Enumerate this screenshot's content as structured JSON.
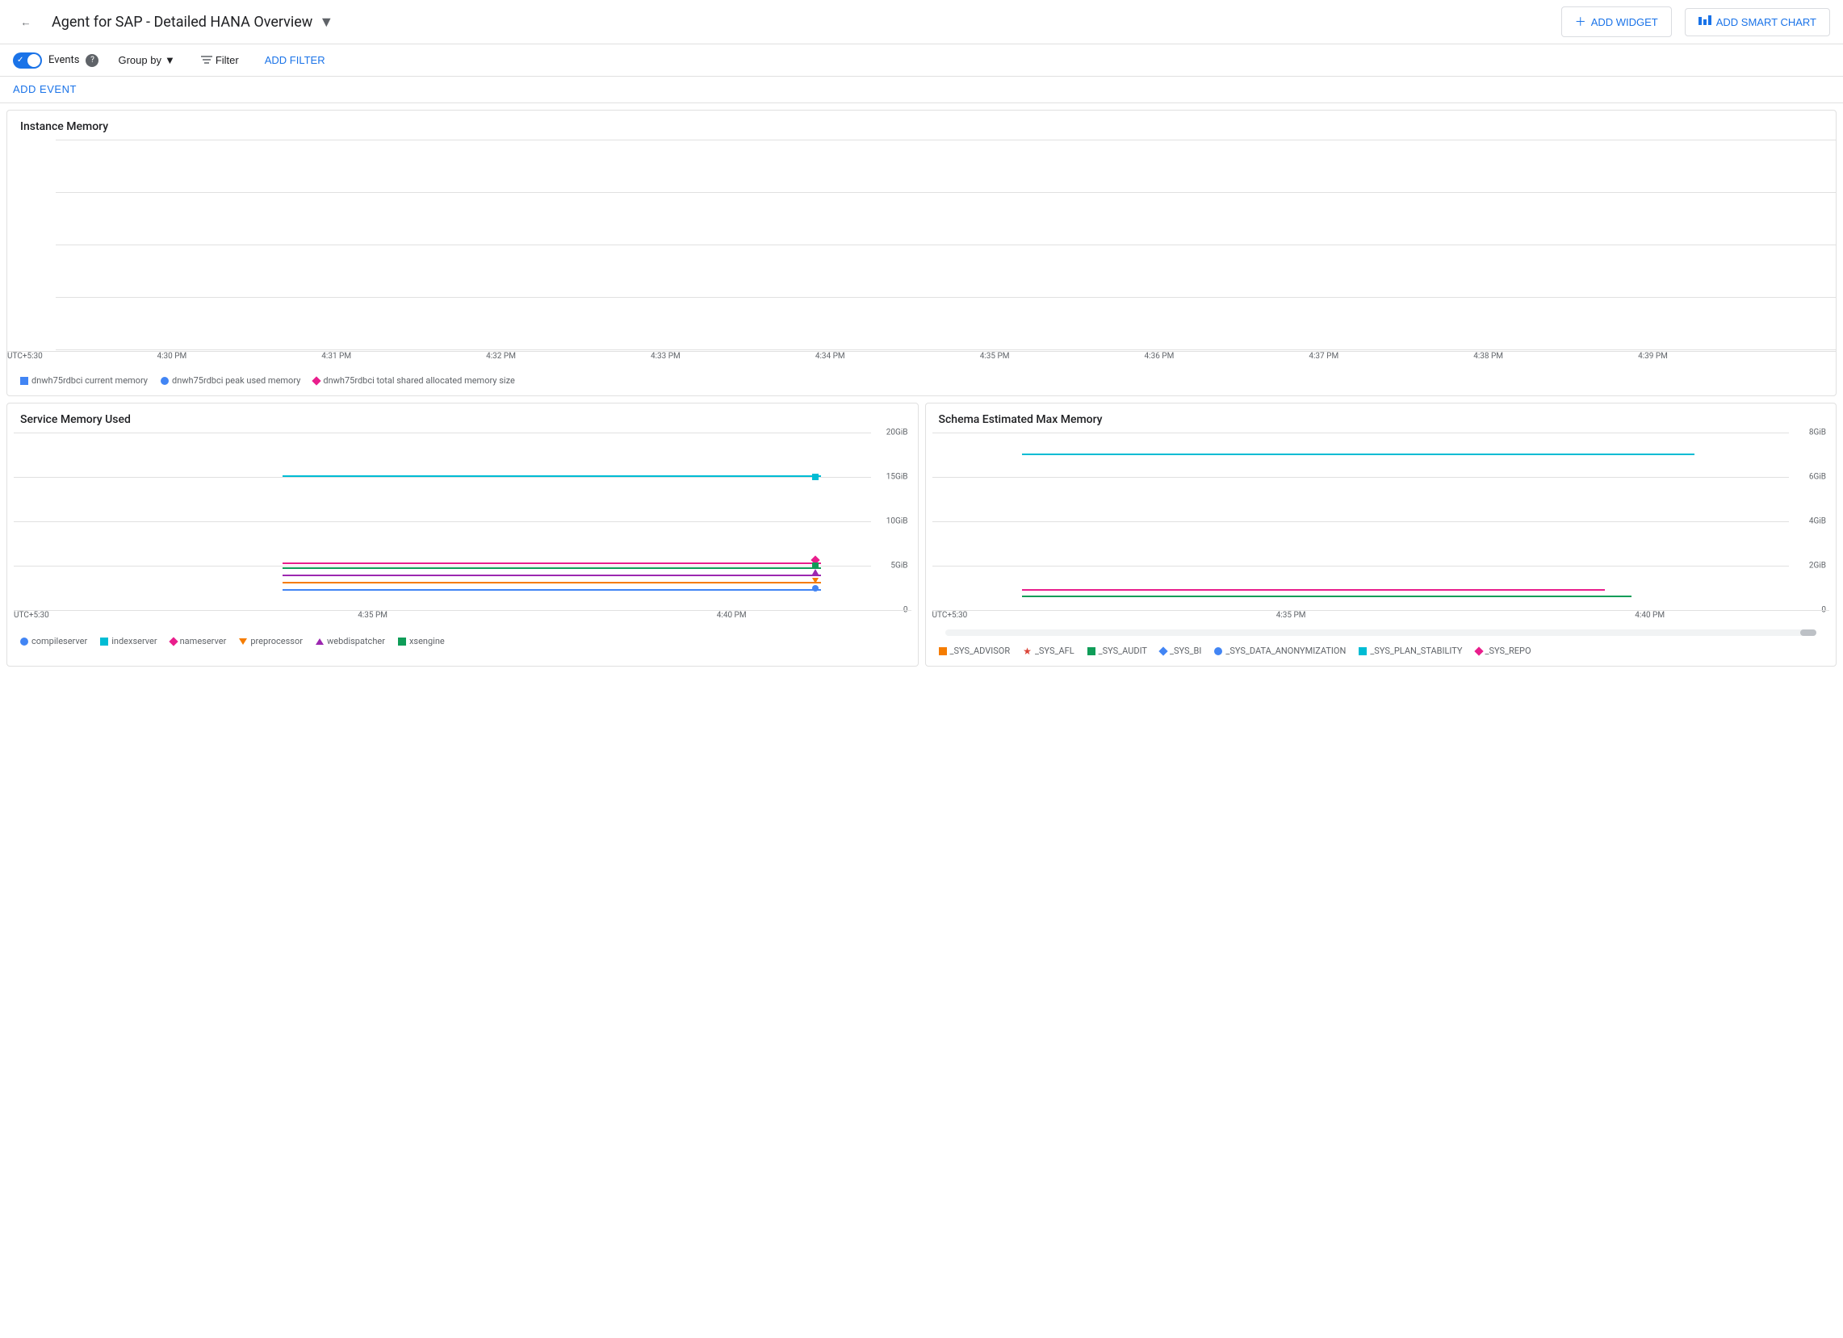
{
  "header": {
    "title": "Agent for SAP - Detailed HANA Overview",
    "title_dropdown_char": "▾",
    "back_icon": "←",
    "add_widget_label": "ADD WIDGET",
    "add_smart_chart_label": "ADD SMART CHART"
  },
  "toolbar": {
    "events_label": "Events",
    "group_by_label": "Group by",
    "filter_label": "Filter",
    "add_filter_label": "ADD FILTER"
  },
  "add_event": {
    "label": "ADD EVENT"
  },
  "instance_memory_chart": {
    "title": "Instance Memory",
    "x_labels": [
      "UTC+5:30",
      "4:30 PM",
      "4:31 PM",
      "4:32 PM",
      "4:33 PM",
      "4:34 PM",
      "4:35 PM",
      "4:36 PM",
      "4:37 PM",
      "4:38 PM",
      "4:39 PM"
    ],
    "legend": [
      {
        "type": "square",
        "color": "#4285f4",
        "label": "dnwh75rdbci current memory"
      },
      {
        "type": "circle",
        "color": "#4285f4",
        "label": "dnwh75rdbci peak used memory"
      },
      {
        "type": "diamond",
        "color": "#e91e8c",
        "label": "dnwh75rdbci total shared allocated memory size"
      }
    ]
  },
  "service_memory_chart": {
    "title": "Service Memory Used",
    "y_labels": [
      "20GiB",
      "15GiB",
      "10GiB",
      "5GiB",
      "0"
    ],
    "x_labels": [
      "UTC+5:30",
      "4:35 PM",
      "4:40 PM"
    ],
    "legend": [
      {
        "type": "circle",
        "color": "#4285f4",
        "label": "compileserver"
      },
      {
        "type": "square",
        "color": "#0f9d58",
        "label": "indexserver"
      },
      {
        "type": "diamond",
        "color": "#e91e8c",
        "label": "nameserver"
      },
      {
        "type": "triangle-down",
        "color": "#f57c00",
        "label": "preprocessor"
      },
      {
        "type": "triangle-up",
        "color": "#9c27b0",
        "label": "webdispatcher"
      },
      {
        "type": "square",
        "color": "#0f9d58",
        "label": "xsengine"
      }
    ],
    "bars": [
      {
        "color": "#00bcd4",
        "pct_left": 30,
        "pct_width": 60,
        "pct_top": 25,
        "end_type": "square",
        "end_color": "#00bcd4"
      },
      {
        "color": "#e91e8c",
        "pct_left": 30,
        "pct_width": 60,
        "pct_top": 52,
        "end_type": "diamond",
        "end_color": "#e91e8c"
      },
      {
        "color": "#0f9d58",
        "pct_left": 30,
        "pct_width": 60,
        "pct_top": 57,
        "end_type": "square",
        "end_color": "#0f9d58"
      },
      {
        "color": "#9c27b0",
        "pct_left": 30,
        "pct_width": 60,
        "pct_top": 62,
        "end_type": "triangle-up",
        "end_color": "#9c27b0"
      },
      {
        "color": "#f57c00",
        "pct_left": 30,
        "pct_width": 60,
        "pct_top": 67,
        "end_type": "triangle-down",
        "end_color": "#f57c00"
      },
      {
        "color": "#4285f4",
        "pct_left": 30,
        "pct_width": 60,
        "pct_top": 72,
        "end_type": "circle",
        "end_color": "#4285f4"
      }
    ]
  },
  "schema_memory_chart": {
    "title": "Schema Estimated Max Memory",
    "y_labels": [
      "8GiB",
      "6GiB",
      "4GiB",
      "2GiB",
      "0"
    ],
    "x_labels": [
      "UTC+5:30",
      "4:35 PM",
      "4:40 PM"
    ],
    "legend": [
      {
        "type": "square",
        "color": "#f57c00",
        "label": "_SYS_ADVISOR"
      },
      {
        "type": "star",
        "color": "#db4437",
        "label": "_SYS_AFL"
      },
      {
        "type": "square",
        "color": "#0f9d58",
        "label": "_SYS_AUDIT"
      },
      {
        "type": "diamond",
        "color": "#4285f4",
        "label": "_SYS_BI"
      },
      {
        "type": "circle",
        "color": "#4285f4",
        "label": "_SYS_DATA_ANONYMIZATION"
      },
      {
        "type": "square",
        "color": "#00bcd4",
        "label": "_SYS_PLAN_STABILITY"
      },
      {
        "type": "diamond",
        "color": "#e91e8c",
        "label": "_SYS_REPO"
      }
    ],
    "bars": [
      {
        "color": "#00bcd4",
        "pct_left": 10,
        "pct_width": 75,
        "pct_top": 32,
        "end_type": "none"
      },
      {
        "color": "#e91e8c",
        "pct_left": 10,
        "pct_width": 65,
        "pct_top": 78,
        "end_type": "none"
      },
      {
        "color": "#0f9d58",
        "pct_left": 10,
        "pct_width": 68,
        "pct_top": 82,
        "end_type": "none"
      }
    ]
  }
}
